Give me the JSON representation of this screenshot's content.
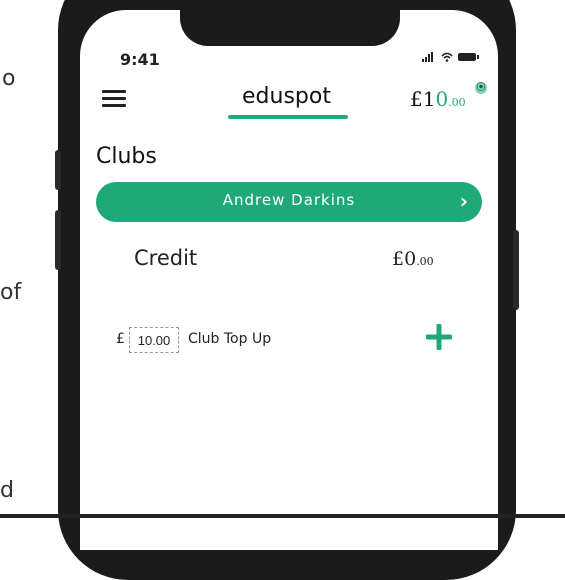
{
  "background_text": {
    "top": "o",
    "middle": "of",
    "bottom": "d"
  },
  "status_bar": {
    "time": "9:41"
  },
  "header": {
    "brand": "eduspot",
    "balance_whole": "£1",
    "balance_zero": "0",
    "balance_cents": ".00"
  },
  "section": {
    "title": "Clubs"
  },
  "student": {
    "name": "Andrew Darkins"
  },
  "credit": {
    "label": "Credit",
    "value": "£0",
    "value_cents": ".00"
  },
  "topup": {
    "currency": "£",
    "amount": "10.00",
    "label": "Club Top Up"
  },
  "colors": {
    "accent": "#1fa979",
    "phone_frame": "#1b1b1b"
  },
  "icons": [
    "menu-icon",
    "wifi-icon",
    "signal-icon",
    "battery-icon",
    "chevron-right-icon",
    "plus-icon",
    "coin-icon"
  ]
}
